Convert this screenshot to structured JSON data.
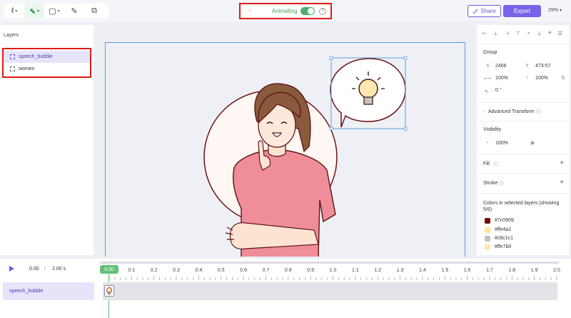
{
  "toolbar": {
    "tools": [
      {
        "name": "pen-tool",
        "glyph": "ℓ",
        "chev": "▾"
      },
      {
        "name": "select-tool",
        "glyph": "⬉",
        "chev": "▾"
      },
      {
        "name": "shape-tool",
        "glyph": "▢",
        "chev": "▾"
      },
      {
        "name": "brush-tool",
        "glyph": "✎"
      },
      {
        "name": "component-tool",
        "glyph": "⧉"
      }
    ],
    "animating_label": "Animating",
    "animating_on": true,
    "share_label": "Share",
    "export_label": "Export",
    "zoom": "29%"
  },
  "layers": {
    "title": "Layers",
    "items": [
      {
        "label": "speech_bubble",
        "selected": true
      },
      {
        "label": "women",
        "selected": false
      }
    ]
  },
  "props": {
    "group_title": "Group",
    "x_label": "X",
    "x_value": "2466",
    "y_label": "Y",
    "y_value": "473:57",
    "w_value": "100%",
    "h_value": "100%",
    "rotation": "0 °",
    "advanced_transform": "Advanced Transform",
    "visibility_title": "Visibility",
    "opacity": "100%",
    "fill_title": "Fill",
    "stroke_title": "Stroke",
    "colors_title": "Colors in selected layers (showing 5/6)",
    "colors": [
      "#7c0909",
      "#ffe4a1",
      "#c6c1c1",
      "#ffe7b0"
    ]
  },
  "timeline": {
    "current_time": "0.00",
    "separator": "/",
    "total_time": "2.00 s",
    "playhead": "0.00",
    "ticks": [
      "0.1",
      "0.2",
      "0.3",
      "0.4",
      "0.5",
      "0.6",
      "0.7",
      "0.8",
      "0.9",
      "1.0",
      "1.1",
      "1.2",
      "1.3",
      "1.4",
      "1.5",
      "1.6",
      "1.7",
      "1.8",
      "1.9",
      "2.0"
    ],
    "track_label": "speech_bubble"
  }
}
